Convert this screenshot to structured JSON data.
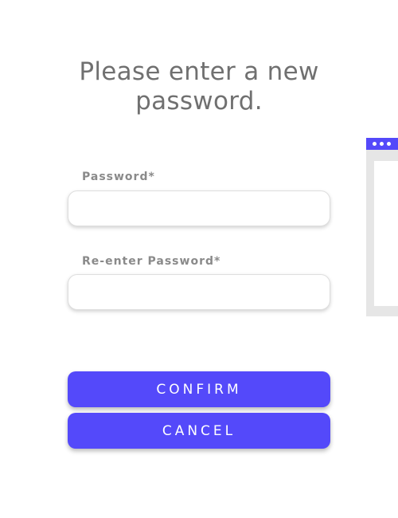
{
  "heading": {
    "line1": "Please enter a new",
    "line2": "password."
  },
  "form": {
    "password_label": "Password*",
    "password_value": "",
    "reenter_label": "Re-enter Password*",
    "reenter_value": ""
  },
  "buttons": {
    "confirm_label": "CONFIRM",
    "cancel_label": "CANCEL"
  },
  "colors": {
    "accent": "#5449fa",
    "heading_text": "#707070",
    "label_text": "#8a8a8a",
    "side_window_frame": "#e6e6e6"
  },
  "icons": {
    "side_window_controls": "window-dots-icon"
  }
}
